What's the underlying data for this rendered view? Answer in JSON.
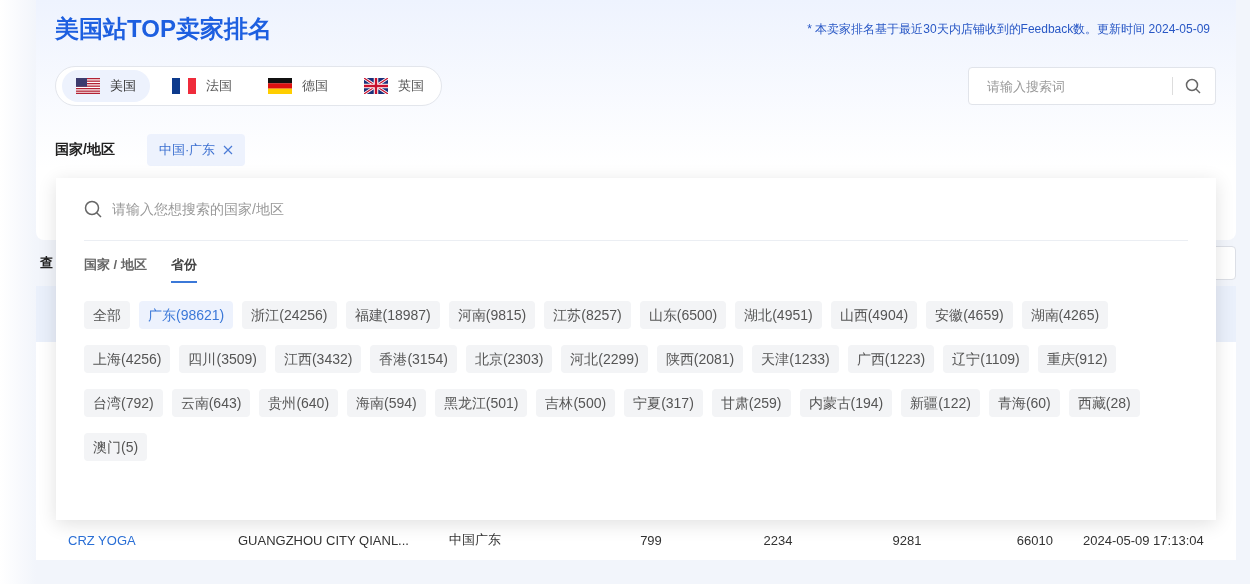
{
  "title": "美国站TOP卖家排名",
  "note": "* 本卖家排名基于最近30天内店铺收到的Feedback数。更新时间 2024-05-09",
  "countries": [
    {
      "name": "美国",
      "kind": "us",
      "selected": true
    },
    {
      "name": "法国",
      "kind": "fr",
      "selected": false
    },
    {
      "name": "德国",
      "kind": "de",
      "selected": false
    },
    {
      "name": "英国",
      "kind": "gb",
      "selected": false
    }
  ],
  "search": {
    "placeholder": "请输入搜索词"
  },
  "filter": {
    "label": "国家/地区",
    "tags": [
      "中国·广东"
    ]
  },
  "query_label": "查",
  "dropdown": {
    "search_placeholder": "请输入您想搜索的国家/地区",
    "tabs": [
      {
        "label": "国家 / 地区",
        "selected": false
      },
      {
        "label": "省份",
        "selected": true
      }
    ],
    "options": [
      {
        "label": "全部",
        "selected": false
      },
      {
        "label": "广东(98621)",
        "selected": true
      },
      {
        "label": "浙江(24256)",
        "selected": false
      },
      {
        "label": "福建(18987)",
        "selected": false
      },
      {
        "label": "河南(9815)",
        "selected": false
      },
      {
        "label": "江苏(8257)",
        "selected": false
      },
      {
        "label": "山东(6500)",
        "selected": false
      },
      {
        "label": "湖北(4951)",
        "selected": false
      },
      {
        "label": "山西(4904)",
        "selected": false
      },
      {
        "label": "安徽(4659)",
        "selected": false
      },
      {
        "label": "湖南(4265)",
        "selected": false
      },
      {
        "label": "上海(4256)",
        "selected": false
      },
      {
        "label": "四川(3509)",
        "selected": false
      },
      {
        "label": "江西(3432)",
        "selected": false
      },
      {
        "label": "香港(3154)",
        "selected": false
      },
      {
        "label": "北京(2303)",
        "selected": false
      },
      {
        "label": "河北(2299)",
        "selected": false
      },
      {
        "label": "陕西(2081)",
        "selected": false
      },
      {
        "label": "天津(1233)",
        "selected": false
      },
      {
        "label": "广西(1223)",
        "selected": false
      },
      {
        "label": "辽宁(1109)",
        "selected": false
      },
      {
        "label": "重庆(912)",
        "selected": false
      },
      {
        "label": "台湾(792)",
        "selected": false
      },
      {
        "label": "云南(643)",
        "selected": false
      },
      {
        "label": "贵州(640)",
        "selected": false
      },
      {
        "label": "海南(594)",
        "selected": false
      },
      {
        "label": "黑龙江(501)",
        "selected": false
      },
      {
        "label": "吉林(500)",
        "selected": false
      },
      {
        "label": "宁夏(317)",
        "selected": false
      },
      {
        "label": "甘肃(259)",
        "selected": false
      },
      {
        "label": "内蒙古(194)",
        "selected": false
      },
      {
        "label": "新疆(122)",
        "selected": false
      },
      {
        "label": "青海(60)",
        "selected": false
      },
      {
        "label": "西藏(28)",
        "selected": false
      },
      {
        "label": "澳门(5)",
        "selected": false
      }
    ]
  },
  "table": {
    "rows": [
      {
        "cells": [
          "CRZ YOGA",
          "GUANGZHOU CITY QIANL...",
          "中国广东",
          "799",
          "2234",
          "9281",
          "66010",
          "2024-05-09 17:13:04"
        ]
      }
    ]
  }
}
